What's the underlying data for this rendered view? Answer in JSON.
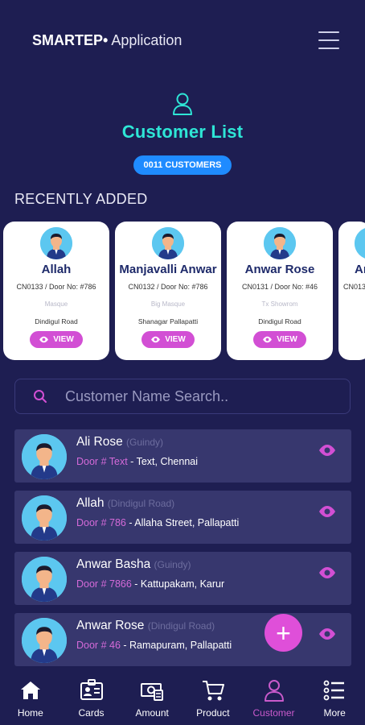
{
  "header": {
    "brand": "SMARTEP",
    "brand_dot": "•",
    "app_name": " Application"
  },
  "hero": {
    "title": "Customer List",
    "count": "0011 CUSTOMERS"
  },
  "recent": {
    "label": "RECENTLY ADDED",
    "view_label": "VIEW",
    "cards": [
      {
        "name": "Allah",
        "info": "CN0133 / Door No: #786",
        "place": "Masque",
        "street": "Dindigul Road"
      },
      {
        "name": "Manjavalli Anwar",
        "info": "CN0132 / Door No: #786",
        "place": "Big Masque",
        "street": "Shanagar Pallapatti"
      },
      {
        "name": "Anwar Rose",
        "info": "CN0131 / Door No: #46",
        "place": "Tx Showrom",
        "street": "Dindigul Road"
      },
      {
        "name": "An",
        "info": "CN013"
      }
    ]
  },
  "search": {
    "placeholder": "Customer Name Search.."
  },
  "customers": [
    {
      "name": "Ali Rose",
      "location": "(Guindy)",
      "door": "Door # Text",
      "address": " - Text, Chennai"
    },
    {
      "name": "Allah",
      "location": "(Dindigul Road)",
      "door": "Door # 786",
      "address": " - Allaha Street, Pallapatti"
    },
    {
      "name": "Anwar Basha",
      "location": "(Guindy)",
      "door": "Door # 7866",
      "address": " - Kattupakam, Karur"
    },
    {
      "name": "Anwar Rose",
      "location": "(Dindigul Road)",
      "door": "Door # 46",
      "address": " - Ramapuram, Pallapatti"
    }
  ],
  "fab": {
    "label": "+"
  },
  "nav": [
    {
      "label": "Home",
      "icon": "home-icon"
    },
    {
      "label": "Cards",
      "icon": "id-card-icon"
    },
    {
      "label": "Amount",
      "icon": "cash-icon"
    },
    {
      "label": "Product",
      "icon": "cart-icon"
    },
    {
      "label": "Customer",
      "icon": "user-icon",
      "active": true
    },
    {
      "label": "More",
      "icon": "list-icon"
    }
  ],
  "colors": {
    "background": "#1e1e52",
    "accent_teal": "#2ee6d6",
    "accent_pink": "#d24fd4",
    "pill_blue": "#1f8bff",
    "row_bg": "#37376e"
  }
}
